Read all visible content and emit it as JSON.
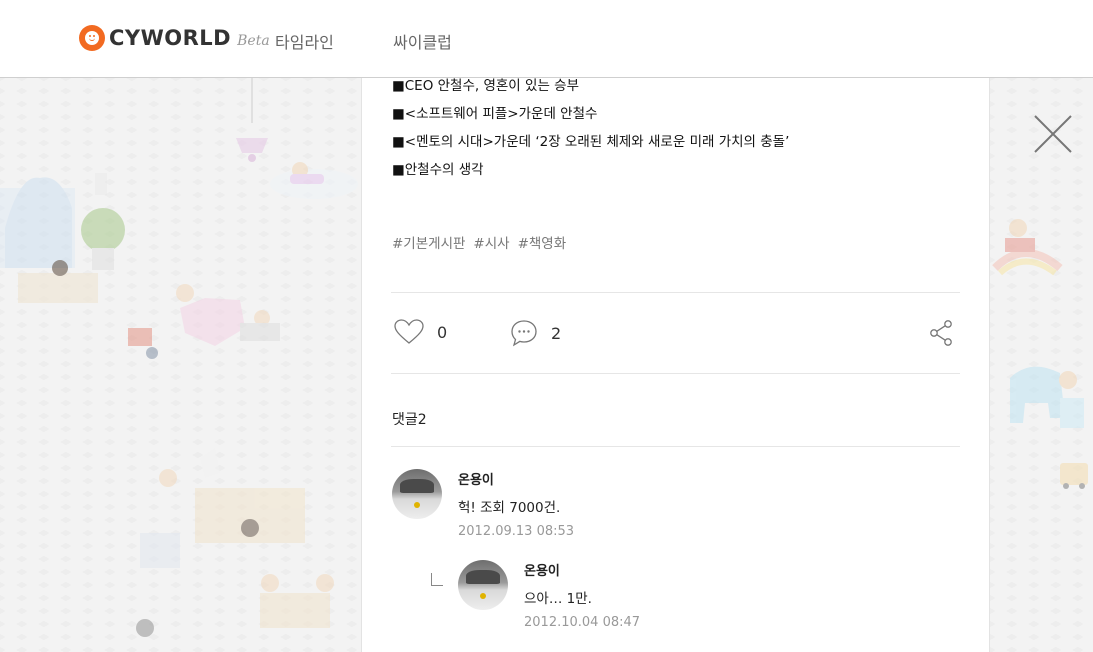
{
  "header": {
    "logo_text": "CYWORLD",
    "logo_beta": "Beta",
    "nav": [
      {
        "label": "타임라인"
      },
      {
        "label": "싸이클럽"
      }
    ]
  },
  "post": {
    "bullets": [
      "■CEO 안철수, 영혼이 있는 승부",
      "■<소프트웨어 피플>가운데 안철수",
      "■<멘토의 시대>가운데 ‘2장 오래된 체제와 새로운 미래 가치의 충돌’",
      "■안철수의 생각"
    ],
    "tags": [
      "#기본게시판",
      "#시사",
      "#책영화"
    ],
    "like_count": "0",
    "comment_count": "2"
  },
  "comments": {
    "title": "댓글2",
    "items": [
      {
        "name": "온용이",
        "text": "헉! 조회 7000건.",
        "date": "2012.09.13 08:53"
      },
      {
        "name": "온용이",
        "text": "으아… 1만.",
        "date": "2012.10.04 08:47"
      }
    ]
  },
  "icons": {
    "like": "heart-icon",
    "comment": "speech-bubble-icon",
    "share": "share-icon",
    "close": "close-icon"
  },
  "colors": {
    "brand": "#f26a21",
    "muted": "#999999"
  }
}
